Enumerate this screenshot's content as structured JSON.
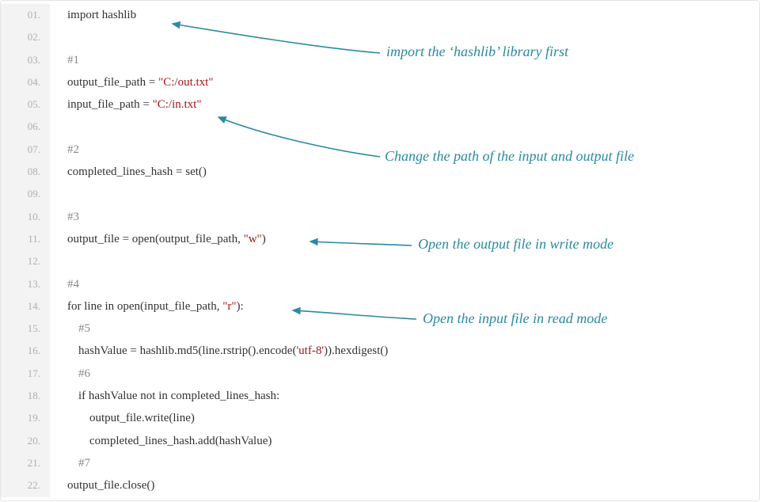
{
  "code": {
    "lines": [
      {
        "n": "01.",
        "spans": [
          [
            "",
            "import hashlib"
          ]
        ]
      },
      {
        "n": "02.",
        "spans": []
      },
      {
        "n": "03.",
        "spans": [
          [
            "cmt",
            "#1"
          ]
        ]
      },
      {
        "n": "04.",
        "spans": [
          [
            "",
            "output_file_path = "
          ],
          [
            "str",
            "\"C:/out.txt\""
          ]
        ]
      },
      {
        "n": "05.",
        "spans": [
          [
            "",
            "input_file_path = "
          ],
          [
            "str",
            "\"C:/in.txt\""
          ]
        ]
      },
      {
        "n": "06.",
        "spans": []
      },
      {
        "n": "07.",
        "spans": [
          [
            "cmt",
            "#2"
          ]
        ]
      },
      {
        "n": "08.",
        "spans": [
          [
            "",
            "completed_lines_hash = set()"
          ]
        ]
      },
      {
        "n": "09.",
        "spans": []
      },
      {
        "n": "10.",
        "spans": [
          [
            "cmt",
            "#3"
          ]
        ]
      },
      {
        "n": "11.",
        "spans": [
          [
            "",
            "output_file = open(output_file_path, "
          ],
          [
            "str",
            "\"w\""
          ],
          [
            "",
            ")"
          ]
        ]
      },
      {
        "n": "12.",
        "spans": []
      },
      {
        "n": "13.",
        "spans": [
          [
            "cmt",
            "#4"
          ]
        ]
      },
      {
        "n": "14.",
        "spans": [
          [
            "",
            "for line in open(input_file_path, "
          ],
          [
            "str",
            "\"r\""
          ],
          [
            "",
            "):"
          ]
        ]
      },
      {
        "n": "15.",
        "indent": 1,
        "spans": [
          [
            "cmt",
            "#5"
          ]
        ]
      },
      {
        "n": "16.",
        "indent": 1,
        "spans": [
          [
            "",
            "hashValue = hashlib.md5(line.rstrip().encode("
          ],
          [
            "str",
            "'utf-8'"
          ],
          [
            "",
            ")).hexdigest()"
          ]
        ]
      },
      {
        "n": "17.",
        "indent": 1,
        "spans": [
          [
            "cmt",
            "#6"
          ]
        ]
      },
      {
        "n": "18.",
        "indent": 1,
        "spans": [
          [
            "",
            "if hashValue not in completed_lines_hash:"
          ]
        ]
      },
      {
        "n": "19.",
        "indent": 2,
        "spans": [
          [
            "",
            "output_file.write(line)"
          ]
        ]
      },
      {
        "n": "20.",
        "indent": 2,
        "spans": [
          [
            "",
            "completed_lines_hash.add(hashValue)"
          ]
        ]
      },
      {
        "n": "21.",
        "indent": 1,
        "spans": [
          [
            "cmt",
            "#7"
          ]
        ]
      },
      {
        "n": "22.",
        "spans": [
          [
            "",
            "output_file.close()"
          ]
        ]
      }
    ]
  },
  "annotations": {
    "a1": "import the ‘hashlib’ library first",
    "a2": "Change the path of the input and output file",
    "a3": "Open the output file in write mode",
    "a4": "Open the input file in read mode"
  },
  "arrows": {
    "color": "#2a8aa0",
    "stroke": 1.6
  }
}
